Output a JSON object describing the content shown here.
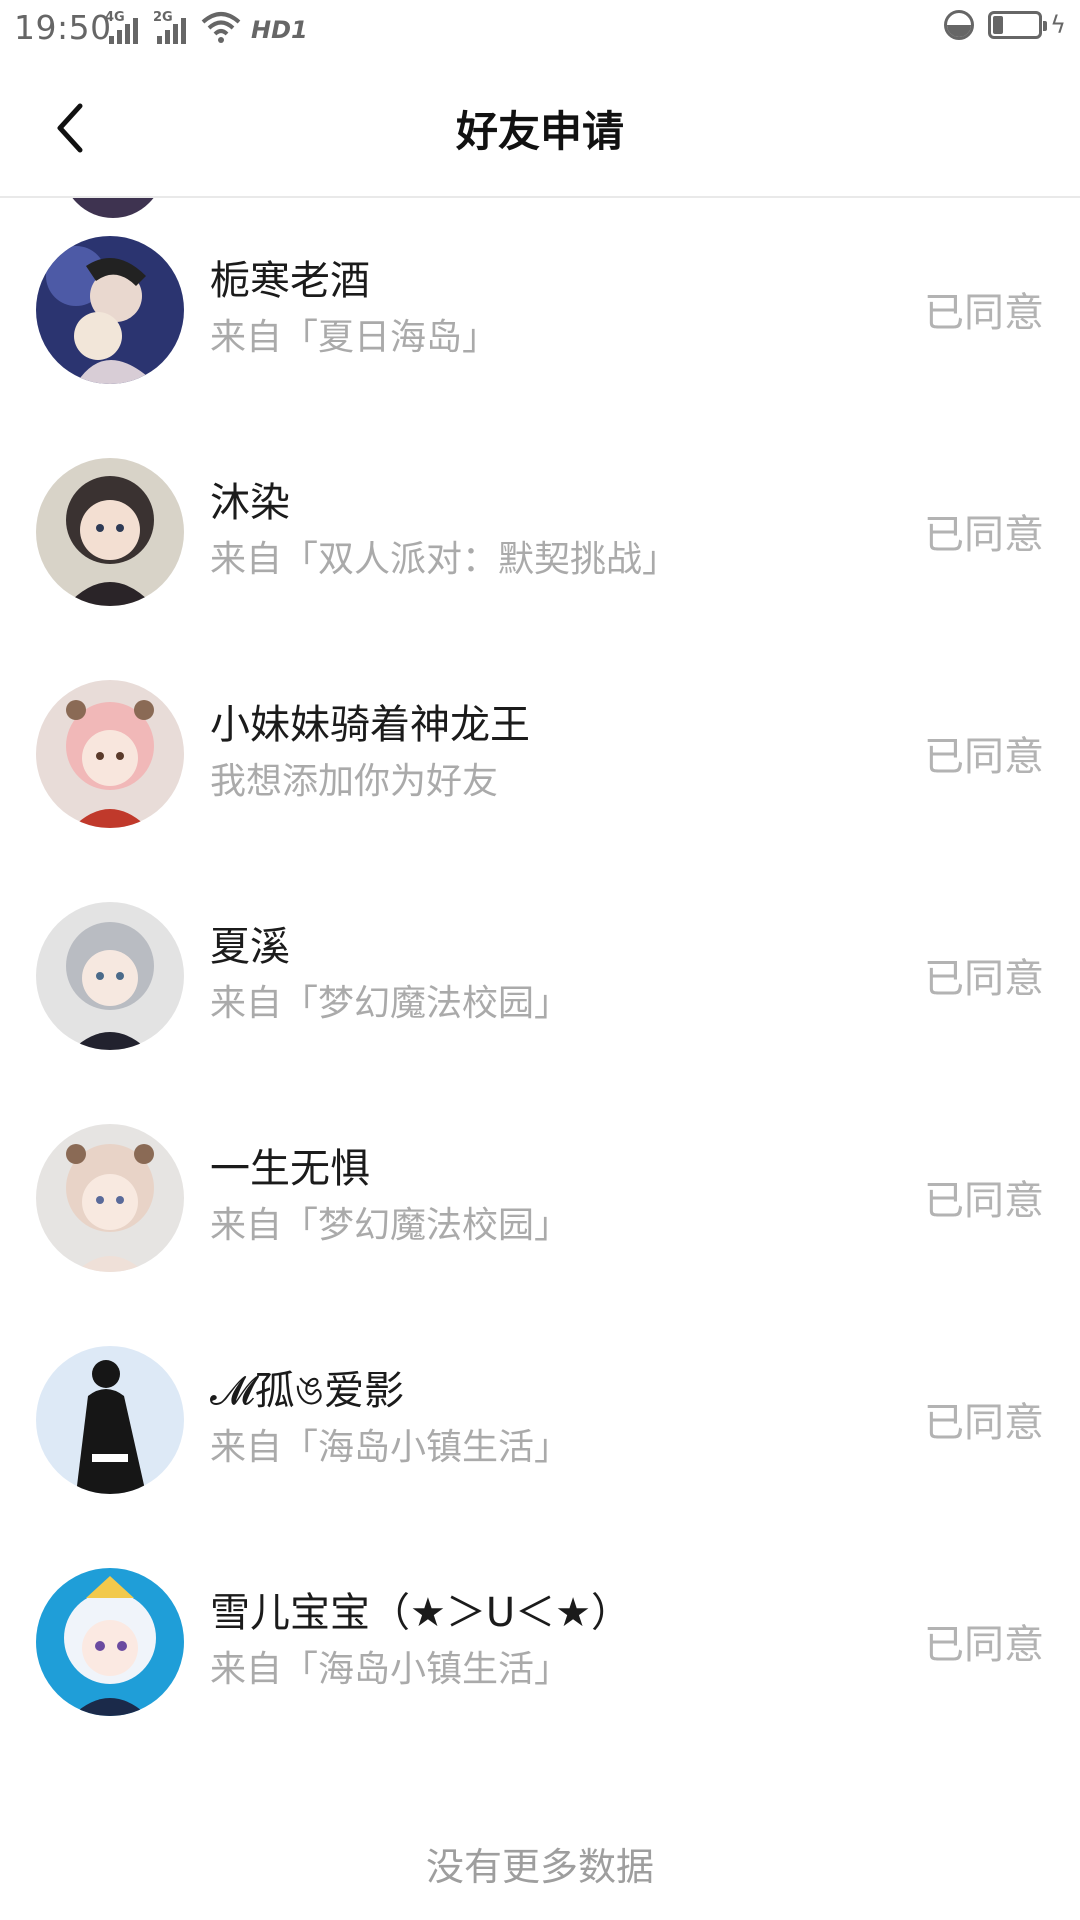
{
  "status_bar": {
    "time": "19:50",
    "signal_1_label": "4G",
    "signal_2_label": "2G",
    "hd_label": "HD1"
  },
  "header": {
    "title": "好友申请",
    "back_icon": "chevron-left-icon"
  },
  "requests": [
    {
      "name": "栀寒老酒",
      "source": "来自「夏日海岛」",
      "status": "已同意",
      "avatar_colors": [
        "#2b3470",
        "#c9b7c4"
      ]
    },
    {
      "name": "沐染",
      "source": "来自「双人派对：默契挑战」",
      "status": "已同意",
      "avatar_colors": [
        "#d8d3c8",
        "#3a3231"
      ]
    },
    {
      "name": "小妹妹骑着神龙王",
      "source": "我想添加你为好友",
      "status": "已同意",
      "avatar_colors": [
        "#e8dcd8",
        "#f1b8b8"
      ]
    },
    {
      "name": "夏溪",
      "source": "来自「梦幻魔法校园」",
      "status": "已同意",
      "avatar_colors": [
        "#e3e3e3",
        "#b9bcc2"
      ]
    },
    {
      "name": "一生无惧",
      "source": "来自「梦幻魔法校园」",
      "status": "已同意",
      "avatar_colors": [
        "#e6e4e2",
        "#e8d3c7"
      ]
    },
    {
      "name": "𝓜孤ঙ爱影",
      "source": "来自「海岛小镇生活」",
      "status": "已同意",
      "avatar_colors": [
        "#dde9f6",
        "#161616"
      ]
    },
    {
      "name": "雪儿宝宝（★＞U＜★）",
      "source": "来自「海岛小镇生活」",
      "status": "已同意",
      "avatar_colors": [
        "#1f9ed8",
        "#ffffff"
      ]
    }
  ],
  "footer": {
    "no_more": "没有更多数据"
  }
}
